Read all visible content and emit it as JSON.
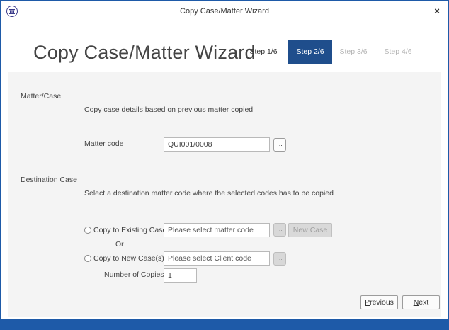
{
  "window": {
    "title": "Copy Case/Matter Wizard",
    "close_label": "×"
  },
  "header": {
    "title": "Copy Case/Matter Wizard",
    "steps": [
      {
        "label": "Step 1/6",
        "state": "done"
      },
      {
        "label": "Step 2/6",
        "state": "active"
      },
      {
        "label": "Step 3/6",
        "state": "pending"
      },
      {
        "label": "Step 4/6",
        "state": "pending"
      }
    ]
  },
  "matter_case": {
    "section_label": "Matter/Case",
    "description": "Copy case details based on previous matter copied",
    "matter_code_label": "Matter code",
    "matter_code_value": "QUI001/0008",
    "browse_label": "..."
  },
  "destination": {
    "section_label": "Destination Case",
    "description": "Select a destination matter code where the selected codes has to be copied",
    "existing_label": "Copy to Existing Case",
    "existing_placeholder": "Please select matter code",
    "existing_browse_label": "...",
    "new_case_button": "New Case",
    "or_label": "Or",
    "new_label": "Copy to New Case(s)",
    "new_placeholder": "Please select Client code",
    "new_browse_label": "...",
    "copies_label": "Number of Copies",
    "copies_value": "1"
  },
  "footer": {
    "previous_prefix": "",
    "previous_underlined": "P",
    "previous_rest": "revious",
    "next_underlined": "N",
    "next_rest": "ext"
  },
  "colors": {
    "accent": "#1f4e8c",
    "window_border": "#1e5aa8"
  }
}
